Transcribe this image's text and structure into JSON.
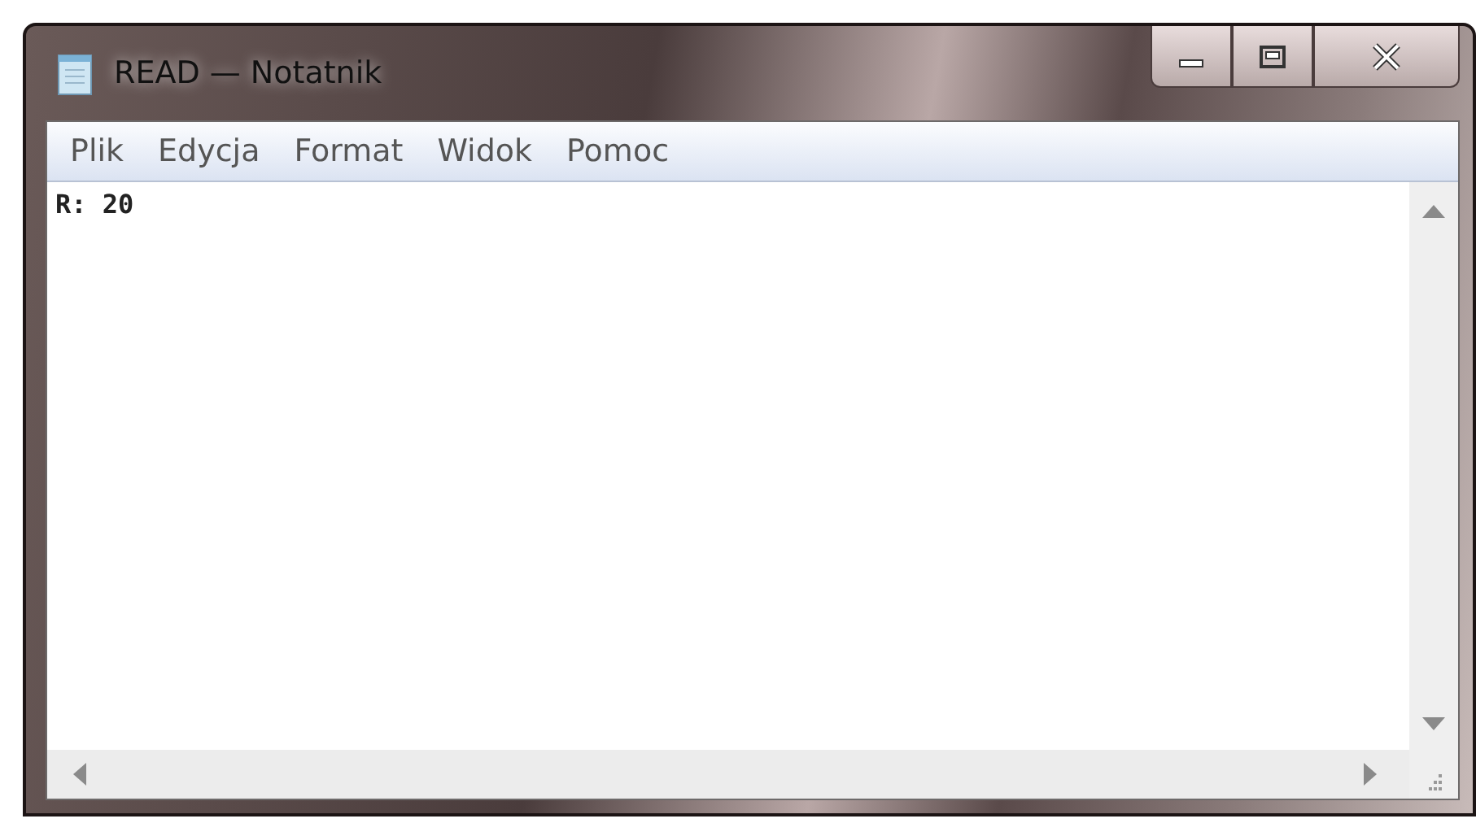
{
  "window": {
    "title": "READ — Notatnik"
  },
  "menu": [
    {
      "label": "Plik"
    },
    {
      "label": "Edycja"
    },
    {
      "label": "Format"
    },
    {
      "label": "Widok"
    },
    {
      "label": "Pomoc"
    }
  ],
  "editor": {
    "text": "R: 20"
  }
}
